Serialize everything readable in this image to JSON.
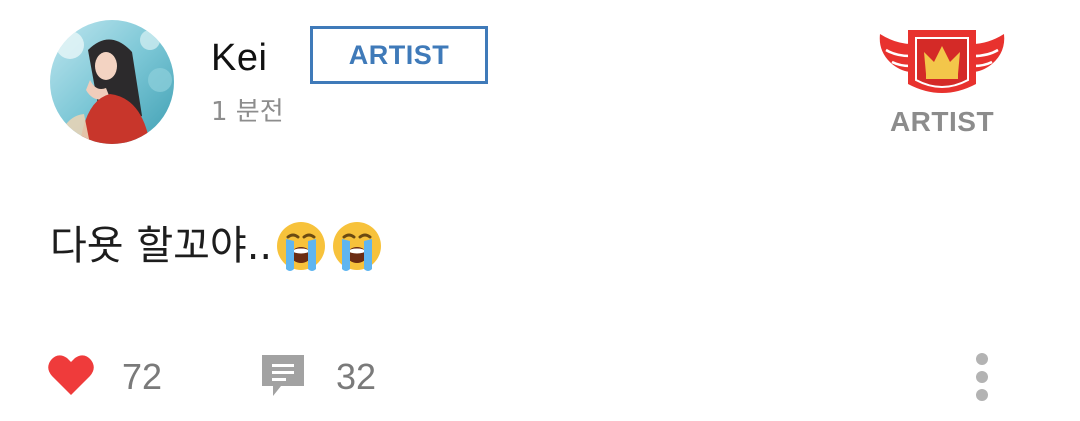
{
  "post": {
    "author": {
      "name": "Kei",
      "role_badge": "ARTIST",
      "avatar_icon": "profile-photo",
      "emblem_icon": "winged-crown-shield-icon",
      "emblem_label": "ARTIST"
    },
    "timestamp": "1 분전",
    "body_text": "다욧 할꼬야..",
    "body_emojis": [
      "loudly-crying-face",
      "loudly-crying-face"
    ],
    "likes": {
      "icon": "heart-icon",
      "count": "72"
    },
    "comments": {
      "icon": "comment-icon",
      "count": "32"
    },
    "more_icon": "more-vertical-icon"
  },
  "colors": {
    "badge_blue": "#3f7ab9",
    "emblem_red": "#e8322e",
    "emblem_gold": "#f3c64a",
    "heart_red": "#ef3b3b",
    "muted_gray": "#8d8d8d",
    "icon_gray": "#a2a2a2"
  }
}
